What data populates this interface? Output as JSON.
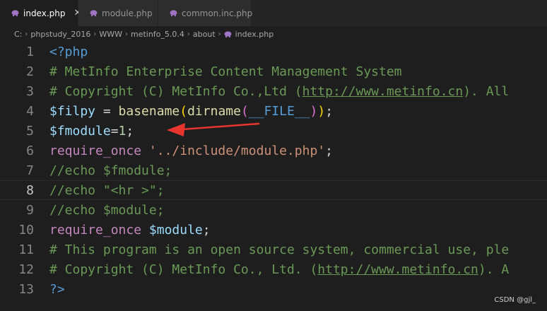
{
  "tabs": [
    {
      "label": "index.php",
      "active": true,
      "close": "✕"
    },
    {
      "label": "module.php",
      "active": false
    },
    {
      "label": "common.inc.php",
      "active": false
    }
  ],
  "breadcrumb": [
    "C:",
    "phpstudy_2016",
    "WWW",
    "metinfo_5.0.4",
    "about",
    "index.php"
  ],
  "editor": {
    "current_line": 8,
    "lines": [
      {
        "n": "1",
        "t": [
          [
            "tag",
            "<?php"
          ]
        ]
      },
      {
        "n": "2",
        "t": [
          [
            "cmt",
            "# MetInfo Enterprise Content Management System"
          ]
        ]
      },
      {
        "n": "3",
        "t": [
          [
            "cmt",
            "# Copyright (C) MetInfo Co.,Ltd ("
          ],
          [
            "cmt url",
            "http://www.metinfo.cn"
          ],
          [
            "cmt",
            "). All"
          ]
        ]
      },
      {
        "n": "4",
        "t": [
          [
            "var",
            "$filpy"
          ],
          [
            "code",
            " = "
          ],
          [
            "fn",
            "basename"
          ],
          [
            "p1",
            "("
          ],
          [
            "fn",
            "dirname"
          ],
          [
            "p2",
            "("
          ],
          [
            "cnst",
            "__FILE__"
          ],
          [
            "p2",
            ")"
          ],
          [
            "p1",
            ")"
          ],
          [
            "code",
            ";"
          ]
        ]
      },
      {
        "n": "5",
        "t": [
          [
            "var",
            "$fmodule"
          ],
          [
            "code",
            "="
          ],
          [
            "num",
            "1"
          ],
          [
            "code",
            ";"
          ]
        ]
      },
      {
        "n": "6",
        "t": [
          [
            "kw",
            "require_once"
          ],
          [
            "code",
            " "
          ],
          [
            "str",
            "'../include/module.php'"
          ],
          [
            "code",
            ";"
          ]
        ]
      },
      {
        "n": "7",
        "t": [
          [
            "cmt",
            "//echo $fmodule;"
          ]
        ]
      },
      {
        "n": "8",
        "t": [
          [
            "cmt",
            "//echo \"<hr >\";"
          ]
        ]
      },
      {
        "n": "9",
        "t": [
          [
            "cmt",
            "//echo $module;"
          ]
        ]
      },
      {
        "n": "10",
        "t": [
          [
            "kw",
            "require_once"
          ],
          [
            "code",
            " "
          ],
          [
            "var",
            "$module"
          ],
          [
            "code",
            ";"
          ]
        ]
      },
      {
        "n": "11",
        "t": [
          [
            "cmt",
            "# This program is an open source system, commercial use, ple"
          ]
        ]
      },
      {
        "n": "12",
        "t": [
          [
            "cmt",
            "# Copyright (C) MetInfo Co., Ltd. ("
          ],
          [
            "cmt url",
            "http://www.metinfo.cn"
          ],
          [
            "cmt",
            "). A"
          ]
        ]
      },
      {
        "n": "13",
        "t": [
          [
            "tag",
            "?>"
          ]
        ]
      }
    ]
  },
  "annotation": {
    "arrow_color": "#e8352e"
  },
  "watermark": "CSDN @gjl_"
}
